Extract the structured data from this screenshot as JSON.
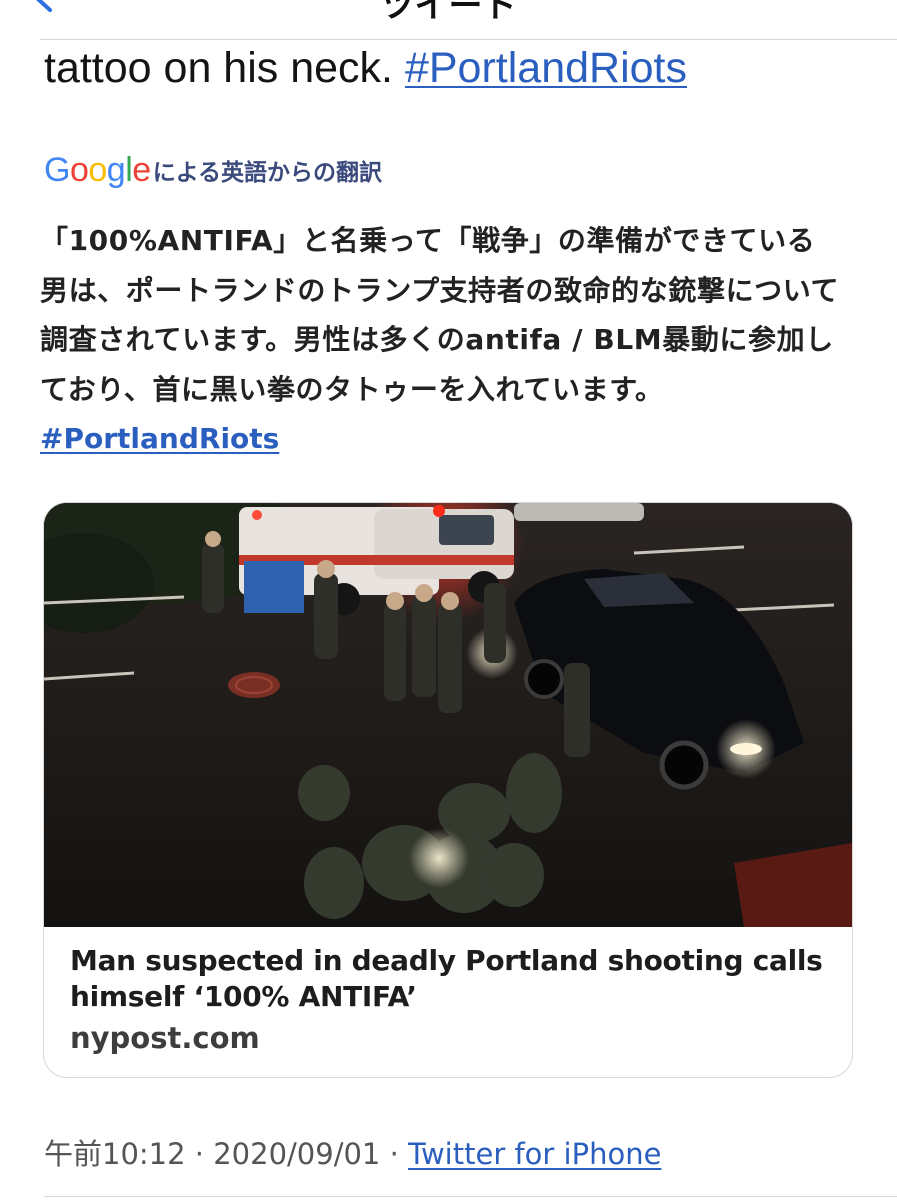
{
  "nav": {
    "title": "ツイート"
  },
  "tweet": {
    "text_end": "tattoo on his neck. ",
    "hashtag": "#PortlandRiots"
  },
  "translation": {
    "provider": [
      "G",
      "o",
      "o",
      "g",
      "l",
      "e"
    ],
    "provider_colors": [
      "#4285F4",
      "#EA4335",
      "#FBBC05",
      "#4285F4",
      "#34A853",
      "#EA4335"
    ],
    "label": "による英語からの翻訳",
    "text": "「100%ANTIFA」と名乗って「戦争」の準備ができている男は、ポートランドのトランプ支持者の致命的な銃撃について調査されています。男性は多くのantifa / BLM暴動に参加しており、首に黒い拳のタトゥーを入れています。",
    "hashtag": "#PortlandRiots"
  },
  "card": {
    "image_icon": "night-street-police-photo",
    "title": "Man suspected in deadly Portland shooting calls himself ‘100% ANTIFA’",
    "domain": "nypost.com"
  },
  "meta": {
    "time": "午前10:12",
    "separator": " · ",
    "date": "2020/09/01",
    "source": "Twitter for iPhone"
  },
  "colors": {
    "link": "#2b5fbf",
    "divider": "#d6d6d6",
    "translated_label": "#3b4a7c"
  }
}
